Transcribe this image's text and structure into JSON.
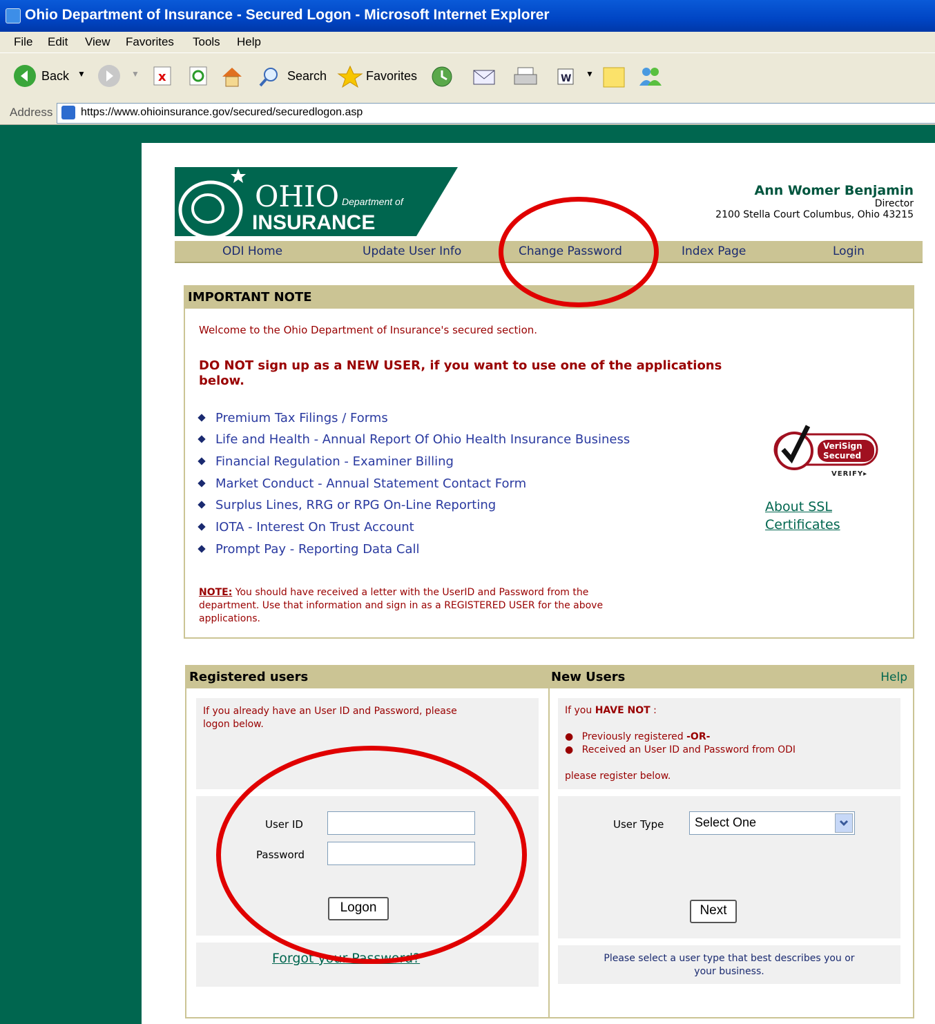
{
  "window": {
    "title": "Ohio Department of Insurance - Secured Logon - Microsoft Internet Explorer"
  },
  "menu": {
    "items": [
      "File",
      "Edit",
      "View",
      "Favorites",
      "Tools",
      "Help"
    ]
  },
  "toolbar": {
    "back_label": "Back",
    "search_label": "Search",
    "favorites_label": "Favorites"
  },
  "address": {
    "label": "Address",
    "url": "https://www.ohioinsurance.gov/secured/securedlogon.asp"
  },
  "header": {
    "logo_ohio": "OHIO",
    "logo_dept": "Department of",
    "logo_insurance": "INSURANCE",
    "director_name": "Ann Womer Benjamin",
    "director_title": "Director",
    "address": "2100 Stella Court Columbus, Ohio 43215"
  },
  "nav": {
    "items": [
      "ODI Home",
      "Update User Info",
      "Change Password",
      "Index Page",
      "Login"
    ]
  },
  "important": {
    "title": "IMPORTANT NOTE",
    "welcome": "Welcome to the Ohio Department of Insurance's secured section.",
    "warning_line1": "DO NOT sign up as a NEW USER, if you want to use one of the applications",
    "warning_line2": "below.",
    "apps": [
      "Premium Tax Filings / Forms",
      "Life and Health - Annual Report Of Ohio Health Insurance Business",
      "Financial Regulation - Examiner Billing",
      "Market Conduct - Annual Statement Contact Form",
      "Surplus Lines, RRG or RPG On-Line Reporting",
      "IOTA - Interest On Trust Account",
      "Prompt Pay - Reporting Data Call"
    ],
    "note_label": "NOTE:",
    "note_line1": " You should have received a letter with the UserID and Password from the",
    "note_line2": "department. Use that information and sign in as a REGISTERED USER for the above",
    "note_line3": "applications.",
    "verisign_line1": "VeriSign",
    "verisign_line2": "Secured",
    "verisign_verify": "VERIFY▸",
    "ssl_line1": "About SSL",
    "ssl_line2": "Certificates"
  },
  "registered": {
    "title": "Registered users",
    "intro_line1": "If you already have an User ID and Password, please",
    "intro_line2": "logon below.",
    "userid_label": "User ID",
    "password_label": "Password",
    "logon_button": "Logon",
    "forgot_link": "Forgot your Password?"
  },
  "newusers": {
    "title": "New Users",
    "help_link": "Help",
    "if_text": "If you ",
    "have_not": "HAVE NOT",
    "colon": " :",
    "bullet1_text": "Previously registered ",
    "bullet1_or": "-OR-",
    "bullet2": "Received an User ID and Password from ODI",
    "register_below": "please register below.",
    "usertype_label": "User Type",
    "usertype_value": "Select One",
    "next_button": "Next",
    "hint_line1": "Please select a user type that best describes you or",
    "hint_line2": "your business."
  }
}
